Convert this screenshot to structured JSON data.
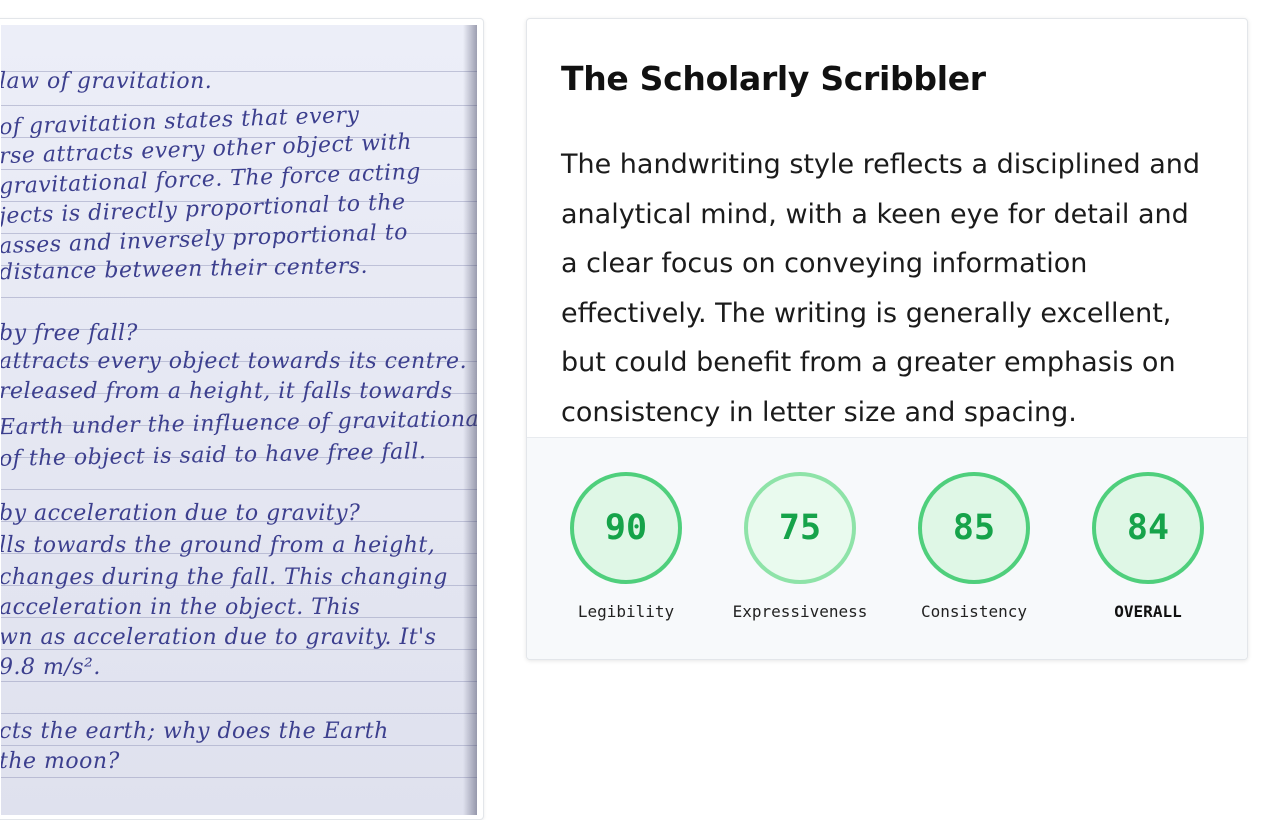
{
  "handwriting_lines": [
    "law of gravitation.",
    "of gravitation states that every",
    "rse attracts every other object with",
    "gravitational force. The force acting",
    "jects is directly proportional to the",
    "asses and inversely proportional to",
    "distance between their centers.",
    "by free fall?",
    "attracts every object towards its centre.",
    "released from a height, it falls towards",
    "Earth under the influence of gravitational",
    "of the object is said to have free fall.",
    "by acceleration due to gravity?",
    "lls towards the ground from a height,",
    "changes during the fall. This changing",
    "acceleration in the object. This",
    "wn as acceleration due to gravity. It's",
    "9.8 m/s².",
    "cts the earth; why does the Earth",
    "the moon?"
  ],
  "card": {
    "title": "The Scholarly Scribbler",
    "description": "The handwriting style reflects a disciplined and analytical mind, with a keen eye for detail and a clear focus on conveying information effectively. The writing is generally excellent, but could benefit from a greater emphasis on consistency in letter size and spacing."
  },
  "scores": [
    {
      "label": "Legibility",
      "value": "90"
    },
    {
      "label": "Expressiveness",
      "value": "75"
    },
    {
      "label": "Consistency",
      "value": "85"
    },
    {
      "label": "OVERALL",
      "value": "84"
    }
  ],
  "colors": {
    "ring_border": "#4fcf7c",
    "ring_fill": "#dff7e6",
    "score_text": "#16a34a",
    "ink": "#3c3f8e"
  }
}
